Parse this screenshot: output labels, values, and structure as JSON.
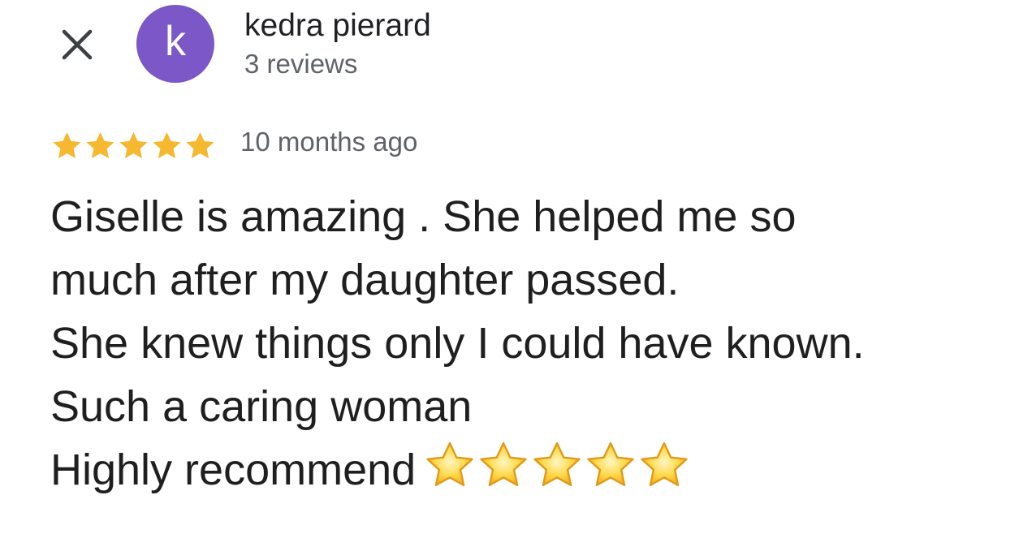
{
  "reviewer": {
    "avatar_letter": "k",
    "avatar_color": "#7b57c8",
    "name": "kedra pierard",
    "reviews_count": "3 reviews"
  },
  "review": {
    "rating": 5,
    "max_rating": 5,
    "star_color": "#f5b82e",
    "date": "10 months ago",
    "lines": [
      "Giselle is amazing . She helped me so",
      "much after my daughter passed.",
      "She knew things only I could have known.",
      "Such a caring woman",
      "Highly recommend"
    ],
    "emoji_stars": "⭐⭐⭐⭐⭐"
  },
  "icons": {
    "close": "close-icon"
  }
}
